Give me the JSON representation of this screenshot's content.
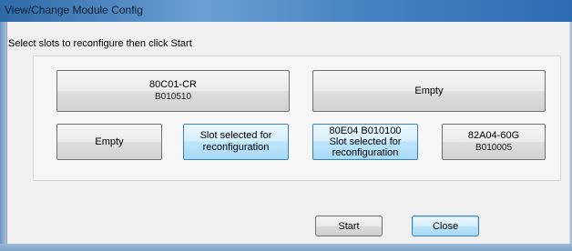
{
  "window": {
    "title": "View/Change Module Config"
  },
  "instruction": "Select slots to reconfigure then click Start",
  "slots": {
    "top_left": {
      "name": "80C01-CR",
      "serial": "B010510"
    },
    "top_right": {
      "name": "Empty"
    },
    "bottom_1": {
      "name": "Empty"
    },
    "bottom_2": {
      "line1": "Slot selected for",
      "line2": "reconfiguration"
    },
    "bottom_3": {
      "line1": "80E04  B010100",
      "line2": "Slot selected for",
      "line3": "reconfiguration"
    },
    "bottom_4": {
      "name": "82A04-60G",
      "serial": "B010005"
    }
  },
  "buttons": {
    "start": "Start",
    "close": "Close"
  }
}
